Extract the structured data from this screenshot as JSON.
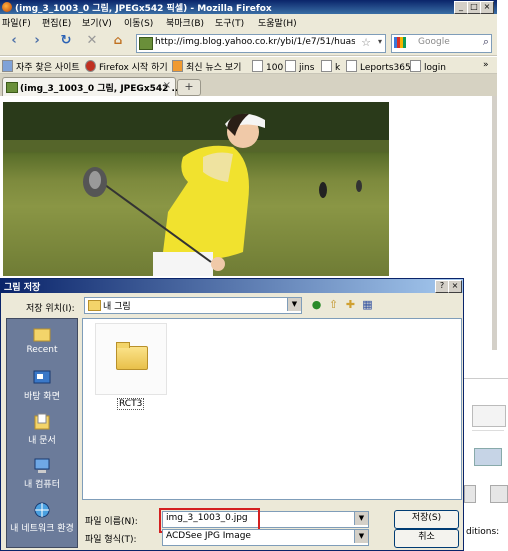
{
  "browser": {
    "title": "(img_3_1003_0 그림, JPEGx542 픽셀) - Mozilla Firefox",
    "menu": [
      "파일(F)",
      "편집(E)",
      "보기(V)",
      "이동(S)",
      "북마크(B)",
      "도구(T)",
      "도움말(H)"
    ],
    "url": "http://img.blog.yahoo.co.kr/ybi/1/e7/51/huashir",
    "search_placeholder": "Google",
    "bookmarks": [
      "자주 찾은 사이트",
      "Firefox 시작 하기",
      "최신 뉴스 보기",
      "100",
      "jins",
      "k",
      "Leports365",
      "login"
    ],
    "bookmarks_overflow": "»",
    "tab_label": "(img_3_1003_0 그림, JPEGx542 ...",
    "new_tab": "+",
    "window_buttons": [
      "_",
      "□",
      "×"
    ]
  },
  "dialog": {
    "title": "그림 저장",
    "title_buttons": [
      "?",
      "×"
    ],
    "save_in_label": "저장 위치(I):",
    "save_in_value": "내 그림",
    "places": [
      "Recent",
      "바탕 화면",
      "내 문서",
      "내 컴퓨터",
      "내 네트워크 환경"
    ],
    "folder_name": "RCT3",
    "filename_label": "파일 이름(N):",
    "filename_value": "img_3_1003_0.jpg",
    "filetype_label": "파일 형식(T):",
    "filetype_value": "ACDSee JPG Image",
    "save_button": "저장(S)",
    "cancel_button": "취소"
  },
  "background": {
    "fragment_text": "ditions:"
  },
  "colors": {
    "titlebar": "#0a246a",
    "highlight_box": "#d42020",
    "places_bar": "#6b7b9a"
  }
}
